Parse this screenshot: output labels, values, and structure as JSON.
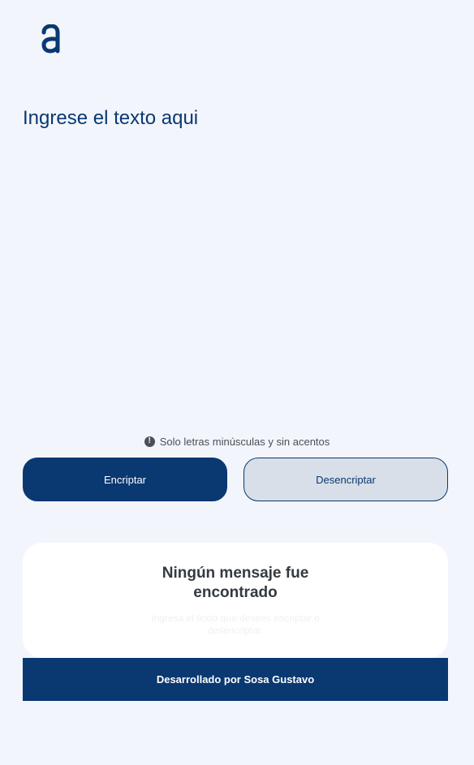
{
  "logo": {
    "icon": "alura-logo-icon"
  },
  "input": {
    "placeholder": "Ingrese el texto aqui",
    "value": ""
  },
  "hint": {
    "icon": "exclamation-circle-icon",
    "text": "Solo letras minúsculas y sin acentos"
  },
  "buttons": {
    "encrypt_label": "Encriptar",
    "decrypt_label": "Desencriptar"
  },
  "output": {
    "title": "Ningún mensaje fue encontrado",
    "text": "Ingresa el texto que desees encriptar o desencriptar."
  },
  "footer": {
    "text": "Desarrollado por Sosa Gustavo"
  },
  "colors": {
    "background": "#f2f5fc",
    "primary": "#0a3871",
    "secondary_button": "#d8dfe8",
    "card": "#ffffff",
    "hint_text": "#495057"
  }
}
